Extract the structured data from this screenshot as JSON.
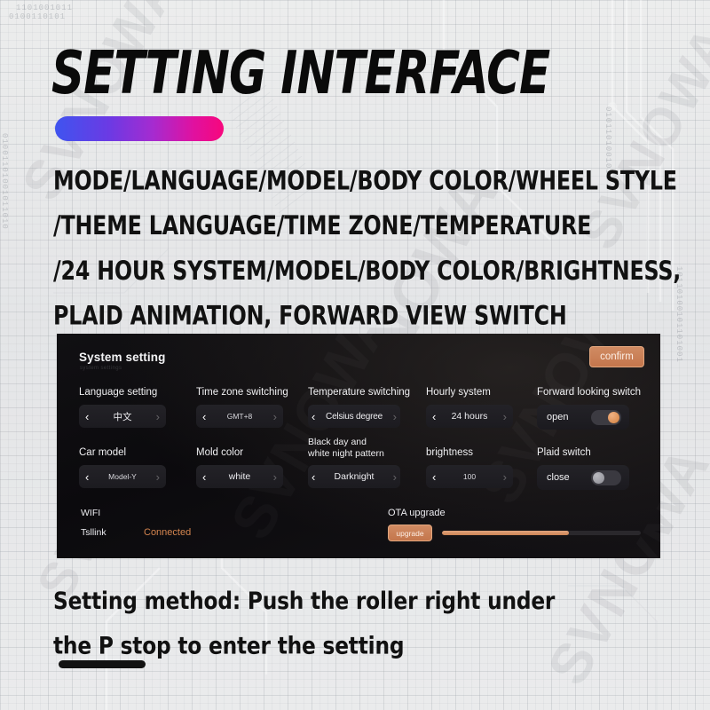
{
  "header": {
    "title": "SETTING INTERFACE",
    "subtitle_lines": [
      "MODE/LANGUAGE/MODEL/BODY COLOR/WHEEL STYLE",
      "/THEME LANGUAGE/TIME ZONE/TEMPERATURE",
      "/24 HOUR SYSTEM/MODEL/BODY COLOR/BRIGHTNESS,",
      "PLAID ANIMATION, FORWARD VIEW SWITCH"
    ],
    "accent_gradient_from": "#3f54ef",
    "accent_gradient_to": "#f7077c"
  },
  "panel": {
    "title": "System setting",
    "confirm_label": "confirm",
    "accent_color": "#c4764c",
    "background_color": "#0b0a0d",
    "row1": [
      {
        "label": "Language setting",
        "control": "stepper",
        "value": "中文",
        "prev_icon": "chevron-left-icon",
        "next_icon": "chevron-right-icon"
      },
      {
        "label": "Time zone switching",
        "control": "stepper",
        "value": "GMT+8",
        "prev_icon": "chevron-left-icon",
        "next_icon": "chevron-right-icon"
      },
      {
        "label": "Temperature switching",
        "control": "stepper",
        "value": "Celsius degree",
        "prev_icon": "chevron-left-icon",
        "next_icon": "chevron-right-icon"
      },
      {
        "label": "Hourly system",
        "control": "stepper",
        "value": "24 hours",
        "prev_icon": "chevron-left-icon",
        "next_icon": "chevron-right-icon"
      },
      {
        "label": "Forward looking switch",
        "control": "toggle",
        "value": "open",
        "state": "on"
      }
    ],
    "row2": [
      {
        "label": "Car model",
        "control": "stepper",
        "value": "Model-Y",
        "prev_icon": "chevron-left-icon",
        "next_icon": "chevron-right-icon"
      },
      {
        "label": "Mold color",
        "control": "stepper",
        "value": "white",
        "prev_icon": "chevron-left-icon",
        "next_icon": "chevron-right-icon"
      },
      {
        "label": "Black day and white night pattern",
        "label_line1": "Black day and",
        "label_line2": "white night pattern",
        "control": "stepper",
        "value": "Darknight",
        "prev_icon": "chevron-left-icon",
        "next_icon": "chevron-right-icon"
      },
      {
        "label": "brightness",
        "control": "stepper",
        "value": "100",
        "prev_icon": "chevron-left-icon",
        "next_icon": "chevron-right-icon"
      },
      {
        "label": "Plaid switch",
        "control": "toggle",
        "value": "close",
        "state": "off"
      }
    ],
    "wifi": {
      "label": "WIFI",
      "network": "Tsllink",
      "status": "Connected",
      "status_color": "#d4854f"
    },
    "ota": {
      "label": "OTA upgrade",
      "button_label": "upgrade",
      "progress_percent": 64
    }
  },
  "footer": {
    "caption_lines": [
      "Setting method: Push the roller right under",
      "the P stop to enter the setting"
    ]
  }
}
